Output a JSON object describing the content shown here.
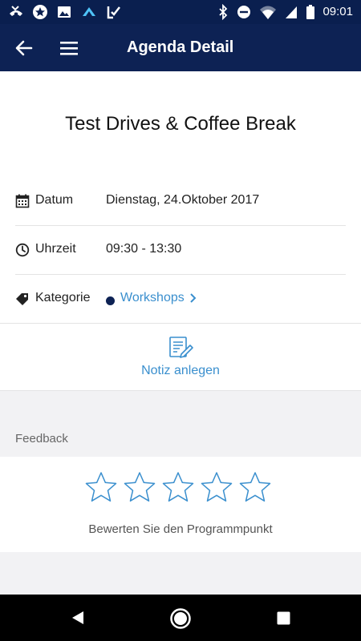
{
  "status_bar": {
    "time": "09:01",
    "left_icons": [
      "missed-call-icon",
      "star-circle-icon",
      "image-icon",
      "cloud-upload-icon",
      "checklist-icon"
    ],
    "right_icons": [
      "bluetooth-icon",
      "dnd-icon",
      "wifi-icon",
      "signal-icon",
      "battery-icon"
    ]
  },
  "app_bar": {
    "title": "Agenda Detail",
    "back_icon": "back-arrow-icon",
    "menu_icon": "hamburger-menu-icon",
    "background": "#0d2254"
  },
  "event": {
    "title": "Test Drives & Coffee Break",
    "details": [
      {
        "icon": "calendar-icon",
        "label": "Datum",
        "value": "Dienstag, 24.Oktober 2017"
      },
      {
        "icon": "clock-icon",
        "label": "Uhrzeit",
        "value": "09:30 - 13:30"
      }
    ],
    "category": {
      "icon": "tag-icon",
      "label": "Kategorie",
      "value": "Workshops",
      "dot_color": "#0d2254"
    }
  },
  "note": {
    "label": "Notiz anlegen",
    "icon": "note-edit-icon"
  },
  "feedback": {
    "header": "Feedback",
    "rating_label": "Bewerten Sie den Programmpunkt",
    "stars_total": 5,
    "stars_selected": 0
  },
  "colors": {
    "accent": "#3a8fce",
    "navy": "#0d2254",
    "grey_bg": "#f2f2f4"
  },
  "nav_bar": {
    "buttons": [
      "back-triangle-icon",
      "home-circle-icon",
      "recents-square-icon"
    ]
  }
}
